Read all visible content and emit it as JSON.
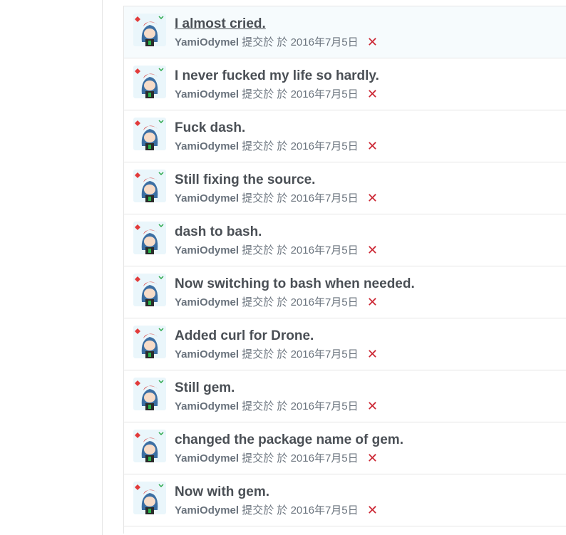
{
  "colors": {
    "title": "#4a4f55",
    "meta": "#6a737d",
    "status_fail": "#cb2431",
    "highlight_bg": "#f6fbfd",
    "border": "#e5e5e5"
  },
  "commits": [
    {
      "title": "I almost cried.",
      "author": "YamiOdymel",
      "submitted": "提交於",
      "date_prefix": "於",
      "date": "2016年7月5日",
      "status_icon": "✕"
    },
    {
      "title": "I never fucked my life so hardly.",
      "author": "YamiOdymel",
      "submitted": "提交於",
      "date_prefix": "於",
      "date": "2016年7月5日",
      "status_icon": "✕"
    },
    {
      "title": "Fuck dash.",
      "author": "YamiOdymel",
      "submitted": "提交於",
      "date_prefix": "於",
      "date": "2016年7月5日",
      "status_icon": "✕"
    },
    {
      "title": "Still fixing the source.",
      "author": "YamiOdymel",
      "submitted": "提交於",
      "date_prefix": "於",
      "date": "2016年7月5日",
      "status_icon": "✕"
    },
    {
      "title": "dash to bash.",
      "author": "YamiOdymel",
      "submitted": "提交於",
      "date_prefix": "於",
      "date": "2016年7月5日",
      "status_icon": "✕"
    },
    {
      "title": "Now switching to bash when needed.",
      "author": "YamiOdymel",
      "submitted": "提交於",
      "date_prefix": "於",
      "date": "2016年7月5日",
      "status_icon": "✕"
    },
    {
      "title": "Added curl for Drone.",
      "author": "YamiOdymel",
      "submitted": "提交於",
      "date_prefix": "於",
      "date": "2016年7月5日",
      "status_icon": "✕"
    },
    {
      "title": "Still gem.",
      "author": "YamiOdymel",
      "submitted": "提交於",
      "date_prefix": "於",
      "date": "2016年7月5日",
      "status_icon": "✕"
    },
    {
      "title": "changed the package name of gem.",
      "author": "YamiOdymel",
      "submitted": "提交於",
      "date_prefix": "於",
      "date": "2016年7月5日",
      "status_icon": "✕"
    },
    {
      "title": "Now with gem.",
      "author": "YamiOdymel",
      "submitted": "提交於",
      "date_prefix": "於",
      "date": "2016年7月5日",
      "status_icon": "✕"
    }
  ]
}
